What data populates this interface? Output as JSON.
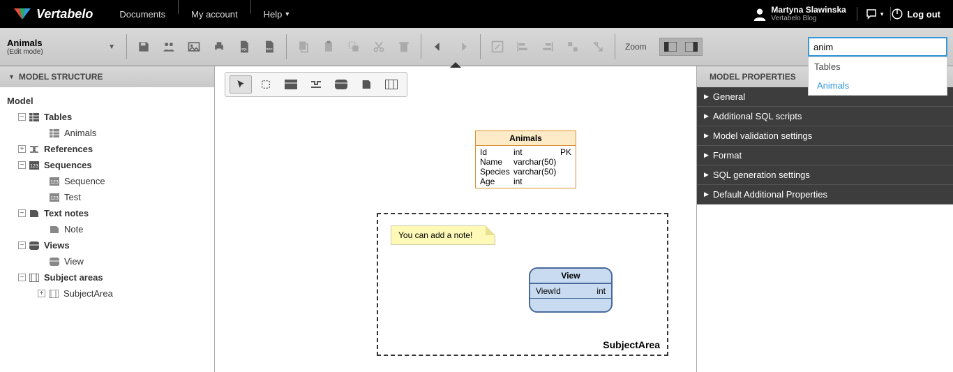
{
  "header": {
    "brand": "Vertabelo",
    "nav": [
      "Documents",
      "My account",
      "Help"
    ],
    "user_name": "Martyna Slawinska",
    "user_sub": "Vertabelo Blog",
    "logout": "Log out"
  },
  "toolbar": {
    "doc_title": "Animals",
    "doc_mode": "(Edit mode)",
    "zoom_label": "Zoom",
    "search_value": "anim",
    "search_dropdown_heading": "Tables",
    "search_dropdown_item": "Animals"
  },
  "left_panel": {
    "title": "MODEL STRUCTURE",
    "tree": {
      "root": "Model",
      "tables": "Tables",
      "tables_children": [
        "Animals"
      ],
      "references": "References",
      "sequences": "Sequences",
      "sequences_children": [
        "Sequence",
        "Test"
      ],
      "textnotes": "Text notes",
      "textnotes_children": [
        "Note"
      ],
      "views": "Views",
      "views_children": [
        "View"
      ],
      "subjectareas": "Subject areas",
      "subjectareas_children": [
        "SubjectArea"
      ]
    }
  },
  "canvas": {
    "table": {
      "name": "Animals",
      "rows": [
        {
          "name": "Id",
          "type": "int",
          "pk": "PK"
        },
        {
          "name": "Name",
          "type": "varchar(50)",
          "pk": ""
        },
        {
          "name": "Species",
          "type": "varchar(50)",
          "pk": ""
        },
        {
          "name": "Age",
          "type": "int",
          "pk": ""
        }
      ]
    },
    "note_text": "You can add a note!",
    "view": {
      "name": "View",
      "col": "ViewId",
      "type": "int"
    },
    "subject_area": "SubjectArea"
  },
  "right_panel": {
    "title": "MODEL PROPERTIES",
    "sections": [
      "General",
      "Additional SQL scripts",
      "Model validation settings",
      "Format",
      "SQL generation settings",
      "Default Additional Properties"
    ]
  }
}
